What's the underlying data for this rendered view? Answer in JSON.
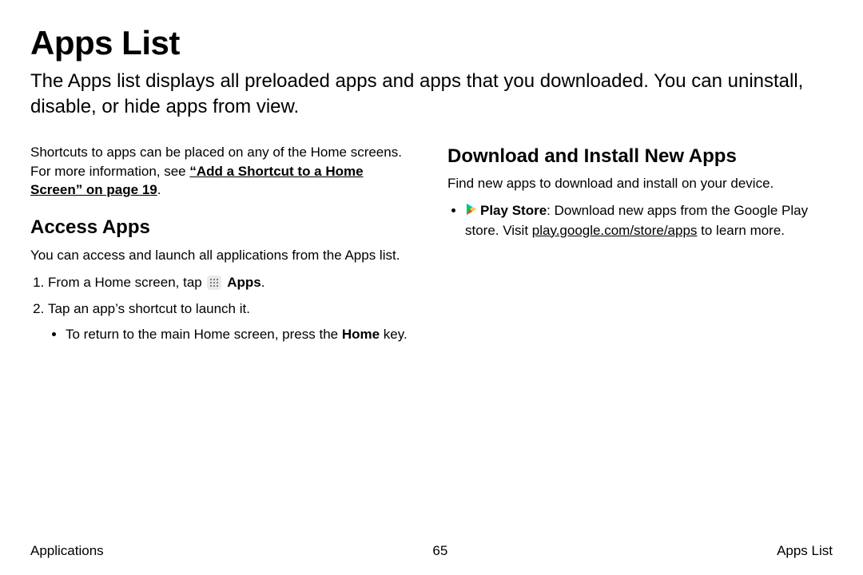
{
  "title": "Apps List",
  "intro": "The Apps list displays all preloaded apps and apps that you downloaded. You can uninstall, disable, or hide apps from view.",
  "left": {
    "shortcuts_prefix": "Shortcuts to apps can be placed on any of the Home screens. For more information, see ",
    "shortcuts_link": "“Add a Shortcut to a Home Screen” on page 19",
    "shortcuts_suffix": ".",
    "h2": "Access Apps",
    "p1": "You can access and launch all applications from the Apps list.",
    "step1_prefix": "From a Home screen, tap ",
    "step1_bold": "Apps",
    "step1_suffix": ".",
    "step2": "Tap an app’s shortcut to launch it.",
    "sub_prefix": "To return to the main Home screen, press the ",
    "sub_bold": "Home",
    "sub_suffix": " key."
  },
  "right": {
    "h2": "Download and Install New Apps",
    "p1": "Find new apps to download and install on your device.",
    "play_label": "Play Store",
    "play_text1": ": Download new apps from the Google Play store. Visit ",
    "play_link": "play.google.com/store/apps",
    "play_text2": " to learn more."
  },
  "footer": {
    "left": "Applications",
    "center": "65",
    "right": "Apps List"
  }
}
